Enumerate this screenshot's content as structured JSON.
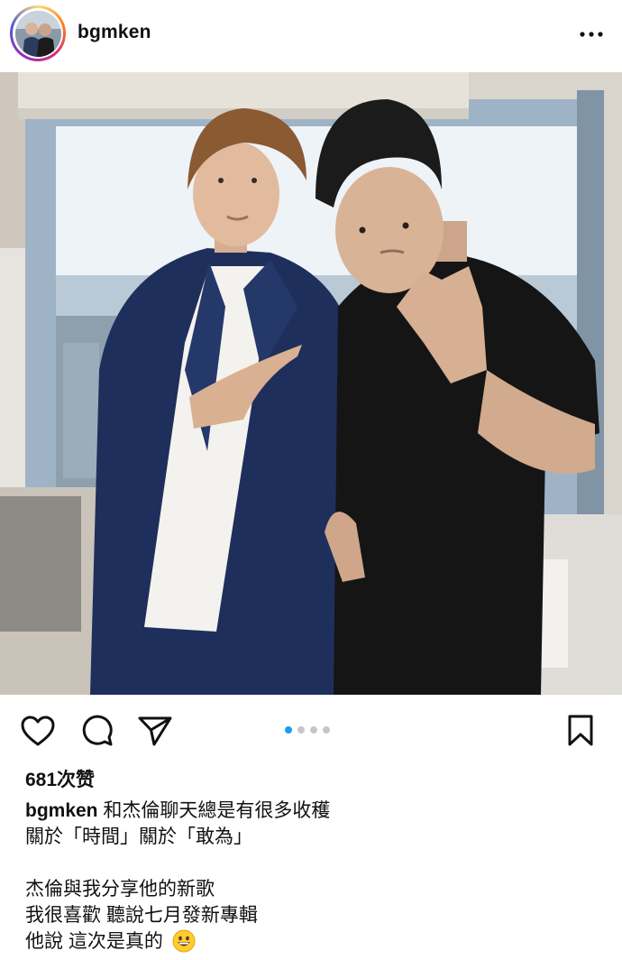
{
  "header": {
    "username": "bgmken",
    "avatar_icon": "profile-photo",
    "more_icon": "more-horizontal-icon"
  },
  "post": {
    "photo_description_icon": "post-photo",
    "carousel": {
      "total": 4,
      "current": 1
    },
    "likes_text": "681次赞"
  },
  "actions": {
    "like_icon": "heart-icon",
    "comment_icon": "comment-icon",
    "share_icon": "send-icon",
    "save_icon": "bookmark-icon"
  },
  "caption": {
    "username": "bgmken",
    "line1": "和杰倫聊天總是有很多收穫",
    "line2": "關於「時間」關於「敢為」",
    "line3": "杰倫與我分享他的新歌",
    "line4": "我很喜歡 聽說七月發新專輯",
    "line5": "他說 這次是真的",
    "emoji_icon": "grinning-face-icon"
  },
  "colors": {
    "carousel_active": "#1d9bf0",
    "carousel_inactive": "#c7c7c7",
    "avatar_ring": "#d62976"
  }
}
